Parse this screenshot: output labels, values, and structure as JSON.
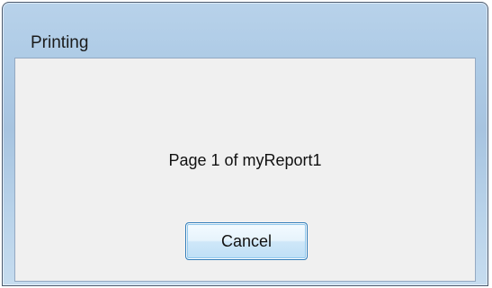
{
  "window": {
    "title": "Printing"
  },
  "dialog": {
    "message": "Page 1 of myReport1",
    "cancel_label": "Cancel"
  }
}
